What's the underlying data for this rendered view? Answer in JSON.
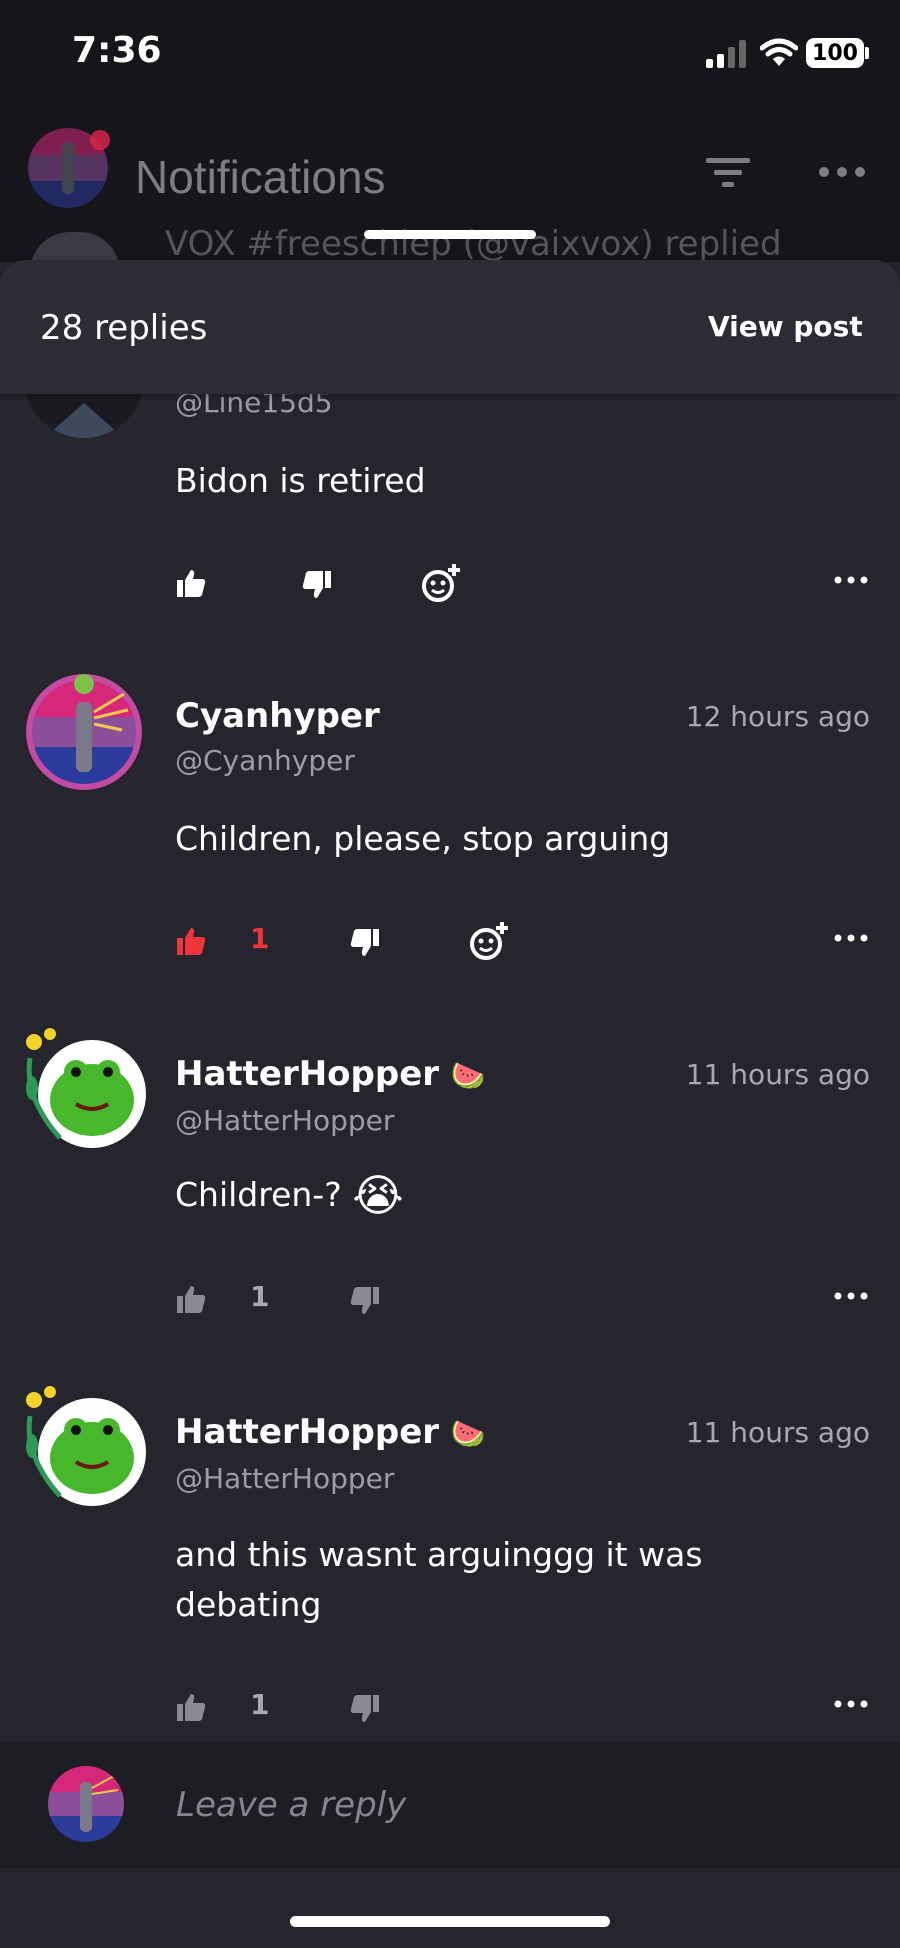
{
  "status_bar": {
    "time": "7:36",
    "battery": "100"
  },
  "header": {
    "title": "Notifications",
    "peek_text": "VOX #freeschlep (@vaixvox) replied"
  },
  "sheet": {
    "replies_count": "28 replies",
    "view_post": "View post"
  },
  "comments": [
    {
      "handle": "@Line15d5",
      "text": "Bidon is retired"
    },
    {
      "username": "Cyanhyper",
      "handle": "@Cyanhyper",
      "time": "12 hours ago",
      "text": "Children, please, stop arguing",
      "likes": "1",
      "liked": true
    },
    {
      "username": "HatterHopper",
      "handle": "@HatterHopper",
      "time": "11 hours ago",
      "text": "Children-?",
      "emoji": "😭",
      "likes": "1",
      "liked": false
    },
    {
      "username": "HatterHopper",
      "handle": "@HatterHopper",
      "time": "11 hours ago",
      "text": "and this wasnt arguinggg it was debating",
      "likes": "1",
      "liked": false
    }
  ],
  "reply": {
    "placeholder": "Leave a reply"
  },
  "colors": {
    "liked": "#f0353a",
    "muted_icon": "#8a8a94",
    "background": "#25252e"
  }
}
